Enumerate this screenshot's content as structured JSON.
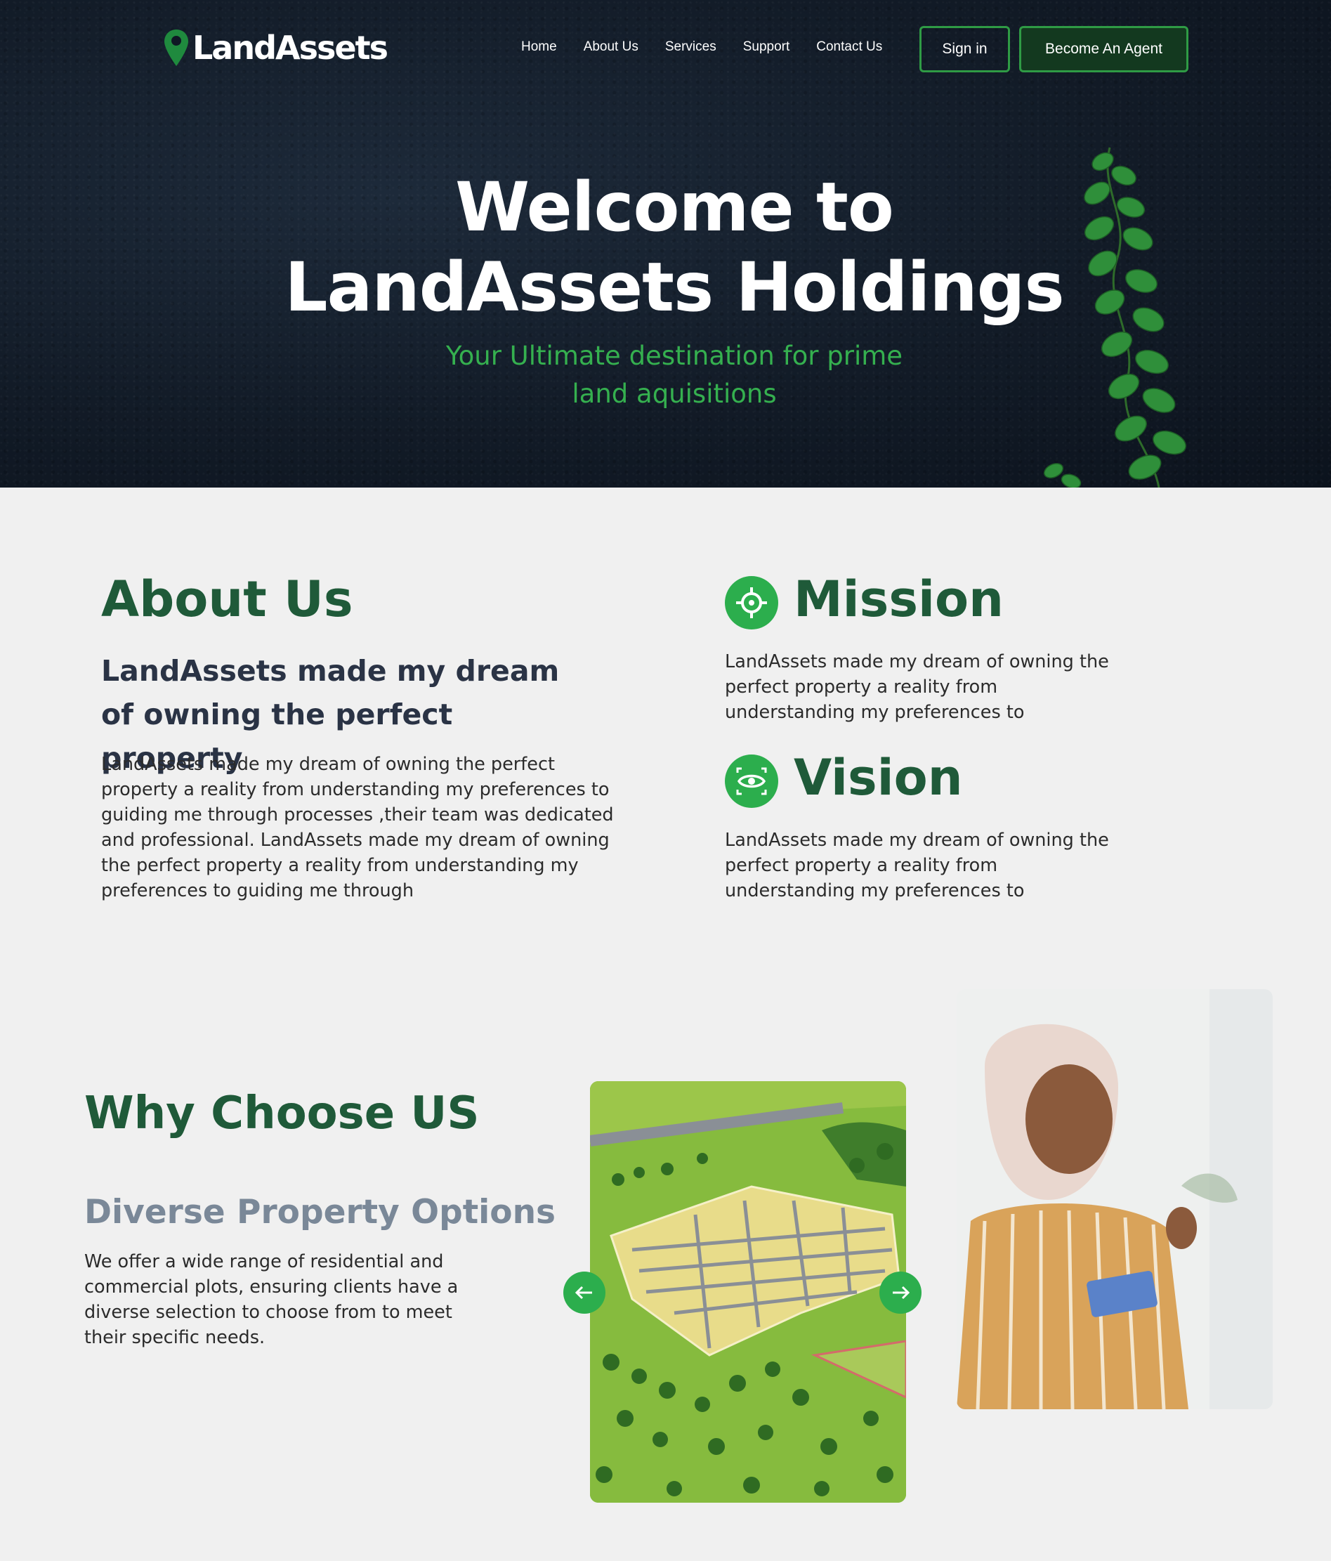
{
  "brand": {
    "name": "LandAssets",
    "accent": "#2cae4d",
    "heading_color": "#1f5a39"
  },
  "nav": {
    "items": [
      "Home",
      "About Us",
      "Services",
      "Support",
      "Contact Us"
    ],
    "sign_in": "Sign in",
    "agent": "Become An Agent"
  },
  "hero": {
    "title_line1": "Welcome to",
    "title_line2": "LandAssets Holdings",
    "subtitle_line1": "Your Ultimate destination for prime",
    "subtitle_line2": "land aquisitions"
  },
  "about": {
    "title": "About Us",
    "subtitle": "LandAssets made my dream of owning the perfect property",
    "body": "LandAssets made my dream of owning the perfect property a reality from understanding my preferences to guiding me through processes ,their team was dedicated and professional. LandAssets made my dream of owning the perfect property a reality from understanding my preferences to guiding me through"
  },
  "mission": {
    "title": "Mission",
    "icon": "target-icon",
    "body": "LandAssets made my dream of owning the perfect property a reality from understanding my preferences to"
  },
  "vision": {
    "title": "Vision",
    "icon": "eye-icon",
    "body": "LandAssets made my dream of owning the perfect property a reality from understanding my preferences to"
  },
  "why": {
    "title": "Why Choose US",
    "subtitle": "Diverse Property Options",
    "body": "We offer a wide range of residential and commercial plots, ensuring clients have a diverse selection to choose from to meet their specific needs.",
    "prev_icon": "arrow-left-icon",
    "next_icon": "arrow-right-icon"
  }
}
